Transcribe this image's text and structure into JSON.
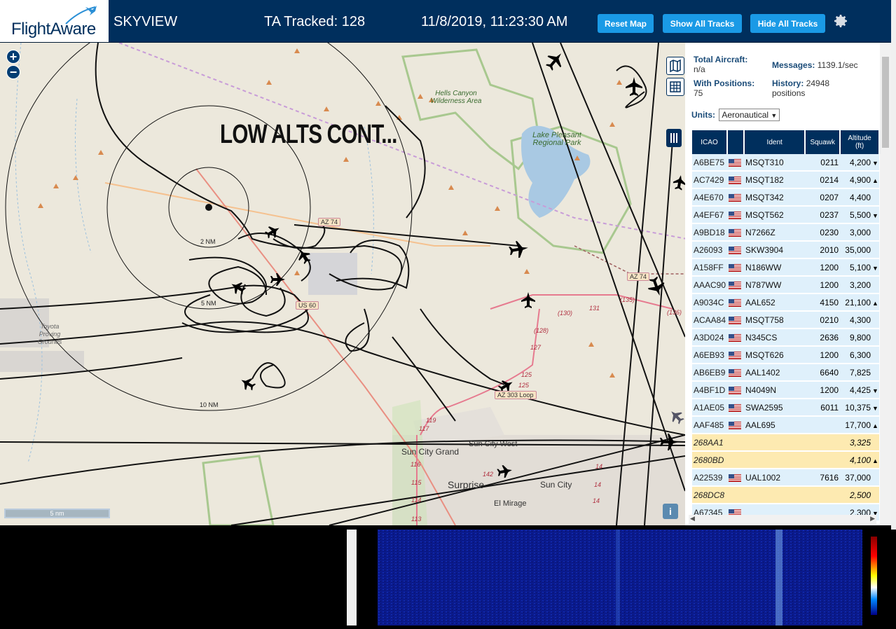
{
  "header": {
    "logo_text": "FlightAware",
    "app_name": "SKYVIEW",
    "tracked_label": "TA Tracked: 128",
    "datetime": "11/8/2019, 11:23:30 AM",
    "btn_reset": "Reset Map",
    "btn_show": "Show All Tracks",
    "btn_hide": "Hide All Tracks",
    "colors": {
      "bar": "#002f5d",
      "button": "#1a9ae6"
    }
  },
  "map": {
    "overlay_title": "LOW ALTS CONT...",
    "zoom_in": "+",
    "zoom_out": "−",
    "scale_label": "5 nm",
    "info_label": "i",
    "range_rings": [
      "2 NM",
      "5 NM",
      "10 NM"
    ],
    "parks": [
      "Hells Canyon Wilderness Area",
      "Lake Pleasant Regional Park",
      "Toyota Proving Grounds"
    ],
    "shields": [
      "AZ 74",
      "US 60",
      "AZ 74",
      "AZ 303 Loop"
    ],
    "cities": [
      "Sun City Grand",
      "Sun City West",
      "Surprise",
      "Sun City",
      "El Mirage"
    ],
    "road_numbers": [
      "(130)",
      "131",
      "(135)",
      "(136)",
      "(128)",
      "127",
      "125",
      "125",
      "119",
      "117",
      "116",
      "115",
      "114",
      "113",
      "142",
      "14",
      "14",
      "14"
    ]
  },
  "sidebar": {
    "total_label": "Total Aircraft:",
    "total_value": "n/a",
    "messages_label": "Messages:",
    "messages_value": "1139.1/sec",
    "positions_label": "With Positions:",
    "positions_value": "75",
    "history_label": "History:",
    "history_value": "24948",
    "history_unit": "positions",
    "units_label": "Units:",
    "units_value": "Aeronautical",
    "columns": {
      "icao": "ICAO",
      "ident": "Ident",
      "squawk": "Squawk",
      "alt_line1": "Altitude",
      "alt_line2": "(ft)"
    },
    "rows": [
      {
        "icao": "A6BE75",
        "ident": "MSQT310",
        "squawk": "0211",
        "alt": "4,200",
        "trend": "▼",
        "flag": true,
        "style": "r"
      },
      {
        "icao": "AC7429",
        "ident": "MSQT182",
        "squawk": "0214",
        "alt": "4,900",
        "trend": "▲",
        "flag": true,
        "style": "r"
      },
      {
        "icao": "A4E670",
        "ident": "MSQT342",
        "squawk": "0207",
        "alt": "4,400",
        "trend": "",
        "flag": true,
        "style": "r"
      },
      {
        "icao": "A4EF67",
        "ident": "MSQT562",
        "squawk": "0237",
        "alt": "5,500",
        "trend": "▼",
        "flag": true,
        "style": "r"
      },
      {
        "icao": "A9BD18",
        "ident": "N7266Z",
        "squawk": "0230",
        "alt": "3,000",
        "trend": "",
        "flag": true,
        "style": "r"
      },
      {
        "icao": "A26093",
        "ident": "SKW3904",
        "squawk": "2010",
        "alt": "35,000",
        "trend": "",
        "flag": true,
        "style": "r"
      },
      {
        "icao": "A158FF",
        "ident": "N186WW",
        "squawk": "1200",
        "alt": "5,100",
        "trend": "▼",
        "flag": true,
        "style": "r"
      },
      {
        "icao": "AAAC90",
        "ident": "N787WW",
        "squawk": "1200",
        "alt": "3,200",
        "trend": "",
        "flag": true,
        "style": "r"
      },
      {
        "icao": "A9034C",
        "ident": "AAL652",
        "squawk": "4150",
        "alt": "21,100",
        "trend": "▲",
        "flag": true,
        "style": "r"
      },
      {
        "icao": "ACAA84",
        "ident": "MSQT758",
        "squawk": "0210",
        "alt": "4,300",
        "trend": "",
        "flag": true,
        "style": "r"
      },
      {
        "icao": "A3D024",
        "ident": "N345CS",
        "squawk": "2636",
        "alt": "9,800",
        "trend": "",
        "flag": true,
        "style": "r"
      },
      {
        "icao": "A6EB93",
        "ident": "MSQT626",
        "squawk": "1200",
        "alt": "6,300",
        "trend": "",
        "flag": true,
        "style": "r"
      },
      {
        "icao": "AB6EB9",
        "ident": "AAL1402",
        "squawk": "6640",
        "alt": "7,825",
        "trend": "",
        "flag": true,
        "style": "r"
      },
      {
        "icao": "A4BF1D",
        "ident": "N4049N",
        "squawk": "1200",
        "alt": "4,425",
        "trend": "▼",
        "flag": true,
        "style": "r"
      },
      {
        "icao": "A1AE05",
        "ident": "SWA2595",
        "squawk": "6011",
        "alt": "10,375",
        "trend": "▼",
        "flag": true,
        "style": "r"
      },
      {
        "icao": "AAF485",
        "ident": "AAL695",
        "squawk": "",
        "alt": "17,700",
        "trend": "▲",
        "flag": true,
        "style": "r"
      },
      {
        "icao": "268AA1",
        "ident": "",
        "squawk": "",
        "alt": "3,325",
        "trend": "",
        "flag": false,
        "style": "n"
      },
      {
        "icao": "2680BD",
        "ident": "",
        "squawk": "",
        "alt": "4,100",
        "trend": "▲",
        "flag": false,
        "style": "n"
      },
      {
        "icao": "A22539",
        "ident": "UAL1002",
        "squawk": "7616",
        "alt": "37,000",
        "trend": "",
        "flag": true,
        "style": "r"
      },
      {
        "icao": "268DC8",
        "ident": "",
        "squawk": "",
        "alt": "2,500",
        "trend": "",
        "flag": false,
        "style": "n"
      },
      {
        "icao": "A67345",
        "ident": "",
        "squawk": "",
        "alt": "2,300",
        "trend": "▼",
        "flag": true,
        "style": "r"
      }
    ]
  }
}
